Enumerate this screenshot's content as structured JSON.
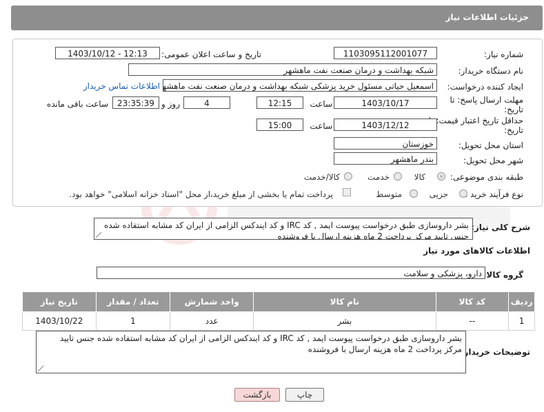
{
  "header": {
    "title": "جزئیات اطلاعات نیاز"
  },
  "form": {
    "need_number_label": "شماره نیاز:",
    "need_number": "1103095112001077",
    "announce_label": "تاریخ و ساعت اعلان عمومی:",
    "announce_value": "1403/10/12 - 12:13",
    "buyer_org_label": "نام دستگاه خریدار:",
    "buyer_org": "شبکه بهداشت و درمان صنعت نفت ماهشهر",
    "requester_label": "ایجاد کننده درخواست:",
    "requester": "اسمعیل حیاتی مسئول خرید پزشکی شبکه بهداشت و درمان صنعت نفت ماهشهر",
    "contact_link": "اطلاعات تماس خریدار",
    "reply_deadline_label_1": "مهلت ارسال پاسخ: تا",
    "reply_deadline_label_2": "تاریخ:",
    "reply_date": "1403/10/17",
    "time_label": "ساعت",
    "reply_time": "12:15",
    "days_value": "4",
    "days_label": "روز و",
    "remaining_value": "23:35:39",
    "remaining_label": "ساعت باقی مانده",
    "price_valid_label_1": "حداقل تاریخ اعتبار قیمت: تا",
    "price_valid_label_2": "تاریخ:",
    "price_valid_date": "1403/12/12",
    "price_valid_time_label": "ساعت",
    "price_valid_time": "15:00",
    "province_label": "استان محل تحویل:",
    "province": "خوزستان",
    "city_label": "شهر محل تحویل:",
    "city": "بندر ماهشهر",
    "category_label": "طبقه بندی موضوعی:",
    "category_options": [
      "کالا",
      "خدمت",
      "کالا/خدمت"
    ],
    "process_label": "نوع فرآیند خرید :",
    "process_options": [
      "جزیی",
      "متوسط"
    ],
    "payment_note": "پرداخت تمام یا بخشی از مبلغ خرید،از محل \"اسناد خزانه اسلامی\" خواهد بود."
  },
  "general_desc": {
    "label": "شرح کلی نیاز:",
    "text": "بشر داروسازی طبق درخواست پیوست ایمد , کد IRC و کد ایندکس الزامی از ایران کد مشابه استفاده شده جنس تایید مرکز پرداخت 2 ماه هزینه ارسال با فروشنده"
  },
  "goods_info_title": "اطلاعات کالاهای مورد نیاز",
  "goods_group": {
    "label": "گروه کالا:",
    "value": "دارو، پزشکی و سلامت"
  },
  "table": {
    "headers": [
      "ردیف",
      "کد کالا",
      "نام کالا",
      "واحد شمارش",
      "تعداد / مقدار",
      "تاریخ نیاز"
    ],
    "rows": [
      [
        "1",
        "--",
        "بشر",
        "عدد",
        "1",
        "1403/10/22"
      ]
    ]
  },
  "buyer_desc": {
    "label": "توضیحات خریدار:",
    "text": "بشر داروسازی طبق درخواست پیوست ایمد , کد IRC و کد ایندکس الزامی از ایران کد مشابه استفاده شده جنس تایید مرکز پرداخت 2 ماه هزینه ارسال با فروشنده"
  },
  "buttons": {
    "print": "چاپ",
    "back": "بازگشت"
  },
  "colors": {
    "header_bg": "#8e8e8e",
    "link": "#1a5fb4",
    "back_btn_bg": "#f8d7d7"
  }
}
